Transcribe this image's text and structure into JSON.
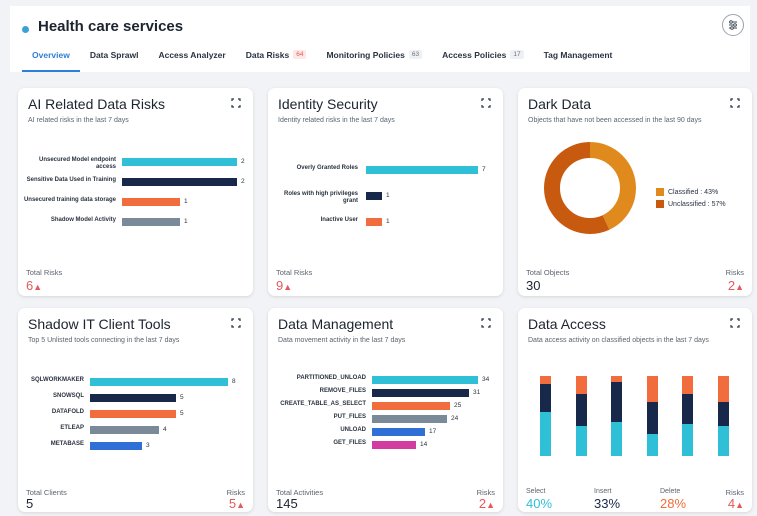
{
  "header": {
    "title": "Health care services",
    "tabs": [
      {
        "label": "Overview",
        "badge": "",
        "active": true
      },
      {
        "label": "Data Sprawl",
        "badge": ""
      },
      {
        "label": "Access Analyzer",
        "badge": ""
      },
      {
        "label": "Data Risks",
        "badge": "64",
        "alert": true
      },
      {
        "label": "Monitoring Policies",
        "badge": "63"
      },
      {
        "label": "Access Policies",
        "badge": "17"
      },
      {
        "label": "Tag Management",
        "badge": ""
      }
    ]
  },
  "colors": {
    "cyan": "#2fbfd6",
    "navy": "#17284a",
    "orange": "#f26d3d",
    "slate": "#7b8a99",
    "blue": "#2f6fd6",
    "magenta": "#d23ca0",
    "dark_orange": "#c85a10",
    "light_orange": "#e08a1e",
    "risk_red": "#e45a5a"
  },
  "cards": {
    "ai_risks": {
      "title": "AI Related Data Risks",
      "subtitle": "AI related risks in the last 7 days",
      "total_label": "Total Risks",
      "total_value": "6",
      "bars": [
        {
          "label": "Unsecured Model endpoint access",
          "value": 2,
          "color": "#2fbfd6"
        },
        {
          "label": "Sensitive Data Used in Training",
          "value": 2,
          "color": "#17284a"
        },
        {
          "label": "Unsecured training data storage",
          "value": 1,
          "color": "#f26d3d"
        },
        {
          "label": "Shadow Model Activity",
          "value": 1,
          "color": "#7b8a99"
        }
      ]
    },
    "identity": {
      "title": "Identity Security",
      "subtitle": "Identity related risks in the last 7 days",
      "total_label": "Total Risks",
      "total_value": "9",
      "bars": [
        {
          "label": "Overly Granted Roles",
          "value": 7,
          "color": "#2fbfd6"
        },
        {
          "label": "Roles with high privileges grant",
          "value": 1,
          "color": "#17284a"
        },
        {
          "label": "Inactive User",
          "value": 1,
          "color": "#f26d3d"
        }
      ]
    },
    "dark_data": {
      "title": "Dark Data",
      "subtitle": "Objects that have not been accessed in the last 90 days",
      "total_label": "Total Objects",
      "total_value": "30",
      "risks_label": "Risks",
      "risks_value": "2",
      "legend": [
        {
          "label": "Classified : 43%",
          "value": 43,
          "color": "#e08a1e"
        },
        {
          "label": "Unclassified : 57%",
          "value": 57,
          "color": "#c85a10"
        }
      ]
    },
    "shadow_it": {
      "title": "Shadow IT Client Tools",
      "subtitle": "Top 5 Unlisted tools connecting in the last 7 days",
      "total_label": "Total Clients",
      "total_value": "5",
      "risks_label": "Risks",
      "risks_value": "5",
      "bars": [
        {
          "label": "SQLWORKMAKER",
          "value": 8,
          "color": "#2fbfd6"
        },
        {
          "label": "SNOWSQL",
          "value": 5,
          "color": "#17284a"
        },
        {
          "label": "DATAFOLD",
          "value": 5,
          "color": "#f26d3d"
        },
        {
          "label": "ETLEAP",
          "value": 4,
          "color": "#7b8a99"
        },
        {
          "label": "METABASE",
          "value": 3,
          "color": "#2f6fd6"
        }
      ]
    },
    "data_mgmt": {
      "title": "Data Management",
      "subtitle": "Data movement activity in the last 7 days",
      "total_label": "Total Activities",
      "total_value": "145",
      "risks_label": "Risks",
      "risks_value": "2",
      "bars": [
        {
          "label": "PARTITIONED_UNLOAD",
          "value": 34,
          "color": "#2fbfd6"
        },
        {
          "label": "REMOVE_FILES",
          "value": 31,
          "color": "#17284a"
        },
        {
          "label": "CREATE_TABLE_AS_SELECT",
          "value": 25,
          "color": "#f26d3d"
        },
        {
          "label": "PUT_FILES",
          "value": 24,
          "color": "#7b8a99"
        },
        {
          "label": "UNLOAD",
          "value": 17,
          "color": "#2f6fd6"
        },
        {
          "label": "GET_FILES",
          "value": 14,
          "color": "#d23ca0"
        }
      ]
    },
    "data_access": {
      "title": "Data Access",
      "subtitle": "Data access activity on classified objects in the last 7 days",
      "risks_label": "Risks",
      "risks_value": "4",
      "stats": [
        {
          "label": "Select",
          "value": "40%",
          "color": "#2fbfd6"
        },
        {
          "label": "Insert",
          "value": "33%",
          "color": "#17284a"
        },
        {
          "label": "Delete",
          "value": "28%",
          "color": "#f26d3d"
        }
      ],
      "columns": [
        {
          "select": 55,
          "insert": 35,
          "delete": 10
        },
        {
          "select": 38,
          "insert": 40,
          "delete": 22
        },
        {
          "select": 42,
          "insert": 50,
          "delete": 8
        },
        {
          "select": 28,
          "insert": 40,
          "delete": 32
        },
        {
          "select": 40,
          "insert": 38,
          "delete": 22
        },
        {
          "select": 38,
          "insert": 30,
          "delete": 32
        }
      ]
    }
  }
}
